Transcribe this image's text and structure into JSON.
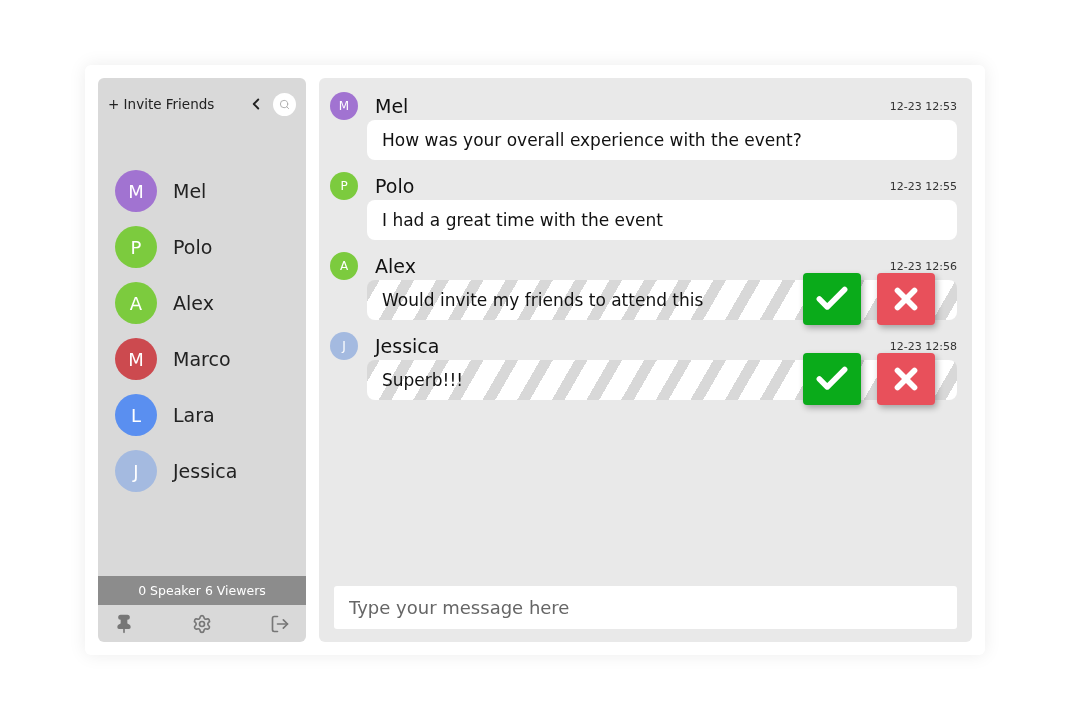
{
  "sidebar": {
    "invite": "+ Invite Friends",
    "contacts": [
      {
        "initial": "M",
        "name": "Mel",
        "color": "#a173d1"
      },
      {
        "initial": "P",
        "name": "Polo",
        "color": "#7ccb3e"
      },
      {
        "initial": "A",
        "name": "Alex",
        "color": "#7ccb3e"
      },
      {
        "initial": "M",
        "name": "Marco",
        "color": "#cc4a4f"
      },
      {
        "initial": "L",
        "name": "Lara",
        "color": "#5a8ff0"
      },
      {
        "initial": "J",
        "name": "Jessica",
        "color": "#a4bae0"
      }
    ],
    "status": "0 Speaker 6 Viewers"
  },
  "messages": [
    {
      "initial": "M",
      "name": "Mel",
      "color": "#a173d1",
      "time": "12-23 12:53",
      "text": "How was your overall experience with the event?",
      "pending": false
    },
    {
      "initial": "P",
      "name": "Polo",
      "color": "#7ccb3e",
      "time": "12-23 12:55",
      "text": "I had a great time with the event",
      "pending": false
    },
    {
      "initial": "A",
      "name": "Alex",
      "color": "#7ccb3e",
      "time": "12-23 12:56",
      "text": "Would invite my friends to attend this",
      "pending": true
    },
    {
      "initial": "J",
      "name": "Jessica",
      "color": "#a4bae0",
      "time": "12-23 12:58",
      "text": "Superb!!!",
      "pending": true
    }
  ],
  "composer": {
    "placeholder": "Type your message here"
  }
}
